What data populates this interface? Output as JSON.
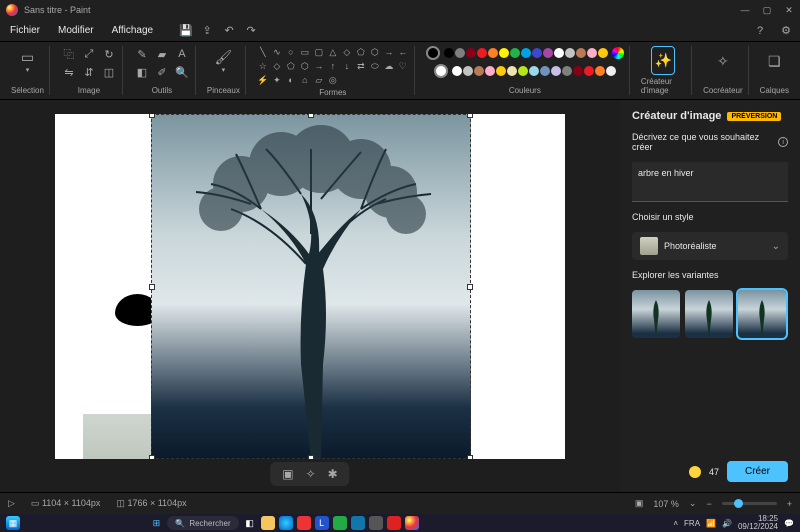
{
  "window": {
    "title": "Sans titre - Paint"
  },
  "menubar": {
    "file": "Fichier",
    "edit": "Modifier",
    "view": "Affichage"
  },
  "ribbon": {
    "selection_label": "Sélection",
    "image_label": "Image",
    "tools_label": "Outils",
    "brushes_label": "Pinceaux",
    "shapes_label": "Formes",
    "colors_label": "Couleurs",
    "image_creator_label": "Créateur d'image",
    "cocreator_label": "Cocréateur",
    "layers_label": "Calques"
  },
  "colors": {
    "selected": "#000000",
    "secondary": "#ffffff",
    "palette_row1": [
      "#000000",
      "#7f7f7f",
      "#880015",
      "#ed1c24",
      "#ff7f27",
      "#fff200",
      "#22b14c",
      "#00a2e8",
      "#3f48cc",
      "#a349a4",
      "#ffffff",
      "#c3c3c3",
      "#b97a57",
      "#ffaec9",
      "#ffc90e"
    ],
    "palette_row2": [
      "#ffffff",
      "#c3c3c3",
      "#b97a57",
      "#ffaec9",
      "#ffc90e",
      "#efe4b0",
      "#b5e61d",
      "#99d9ea",
      "#7092be",
      "#c8bfe7",
      "#7f7f7f",
      "#880015",
      "#ed1c24",
      "#ff7f27",
      "#eeeeee"
    ]
  },
  "sidepanel": {
    "title": "Créateur d'image",
    "badge": "PRÉVERSION",
    "describe_label": "Décrivez ce que vous souhaitez créer",
    "prompt_value": "arbre en hiver",
    "style_label": "Choisir un style",
    "style_selected": "Photoréaliste",
    "variants_label": "Explorer les variantes",
    "credits": "47",
    "create_btn": "Créer"
  },
  "canvas": {
    "selection_toolbar_icons": [
      "crop-icon",
      "rotate-icon",
      "flip-icon"
    ]
  },
  "statusbar": {
    "cursor_icon": "▷",
    "selection_dims": "1104 × 1104px",
    "canvas_dims": "1766 × 1104px",
    "zoom_value": "107 %"
  },
  "taskbar": {
    "search_placeholder": "Rechercher",
    "time": "18:25",
    "date": "09/12/2024"
  }
}
